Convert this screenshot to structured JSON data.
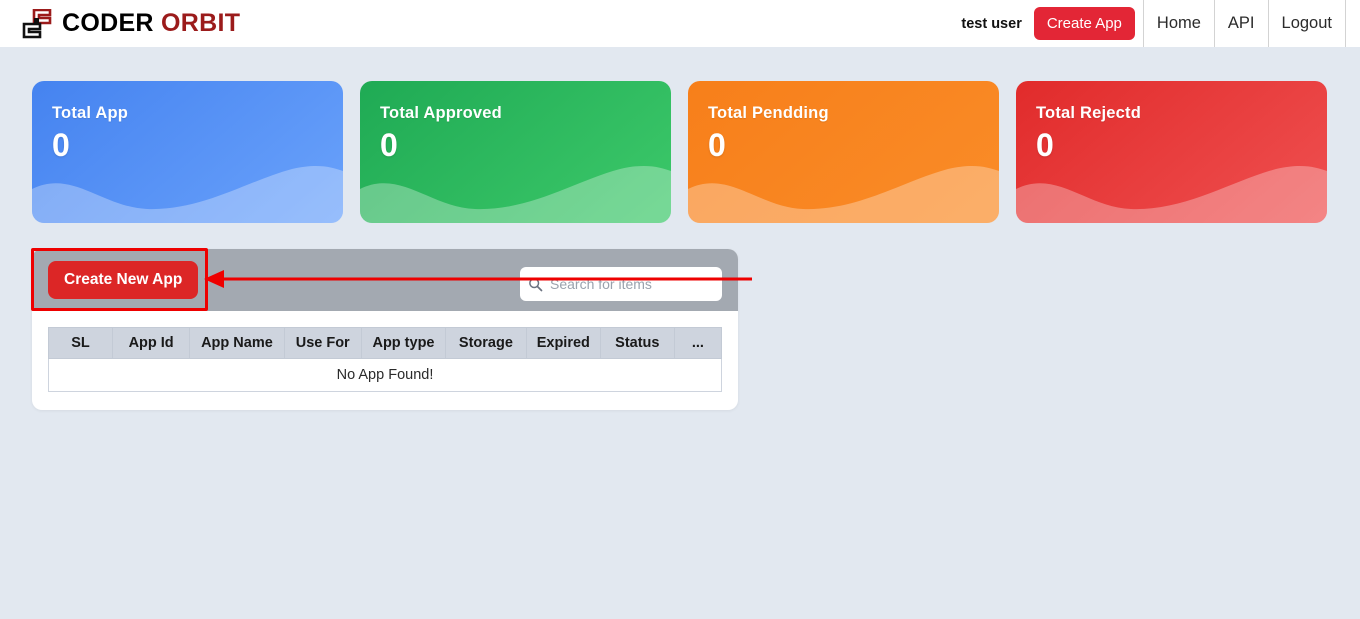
{
  "navbar": {
    "brand": {
      "logo_icon": "coder-orbit-logo-icon",
      "word_one": "CODER",
      "word_two": "ORBIT"
    },
    "user_label": "test user",
    "create_app_label": "Create App",
    "links": [
      {
        "label": "Home"
      },
      {
        "label": "API"
      },
      {
        "label": "Logout"
      }
    ]
  },
  "stat_cards": [
    {
      "title": "Total App",
      "value": "0",
      "color": "#4583f0",
      "theme": "blue"
    },
    {
      "title": "Total Approved",
      "value": "0",
      "color": "#1faa54",
      "theme": "green"
    },
    {
      "title": "Total Pendding",
      "value": "0",
      "color": "#f77f1a",
      "theme": "orange"
    },
    {
      "title": "Total Rejectd",
      "value": "0",
      "color": "#e12b2b",
      "theme": "red"
    }
  ],
  "panel": {
    "toolbar": {
      "create_new_app_label": "Create New App",
      "create_new_app_color": "#dc2626",
      "search": {
        "icon": "search-icon",
        "value": "",
        "placeholder": "Search for items"
      }
    },
    "table": {
      "columns": [
        "SL",
        "App Id",
        "App Name",
        "Use For",
        "App type",
        "Storage",
        "Expired",
        "Status",
        "..."
      ],
      "rows": [],
      "empty_message": "No App Found!"
    }
  },
  "annotation": {
    "highlight_color": "#ee0000",
    "target": "create-new-app-button"
  }
}
